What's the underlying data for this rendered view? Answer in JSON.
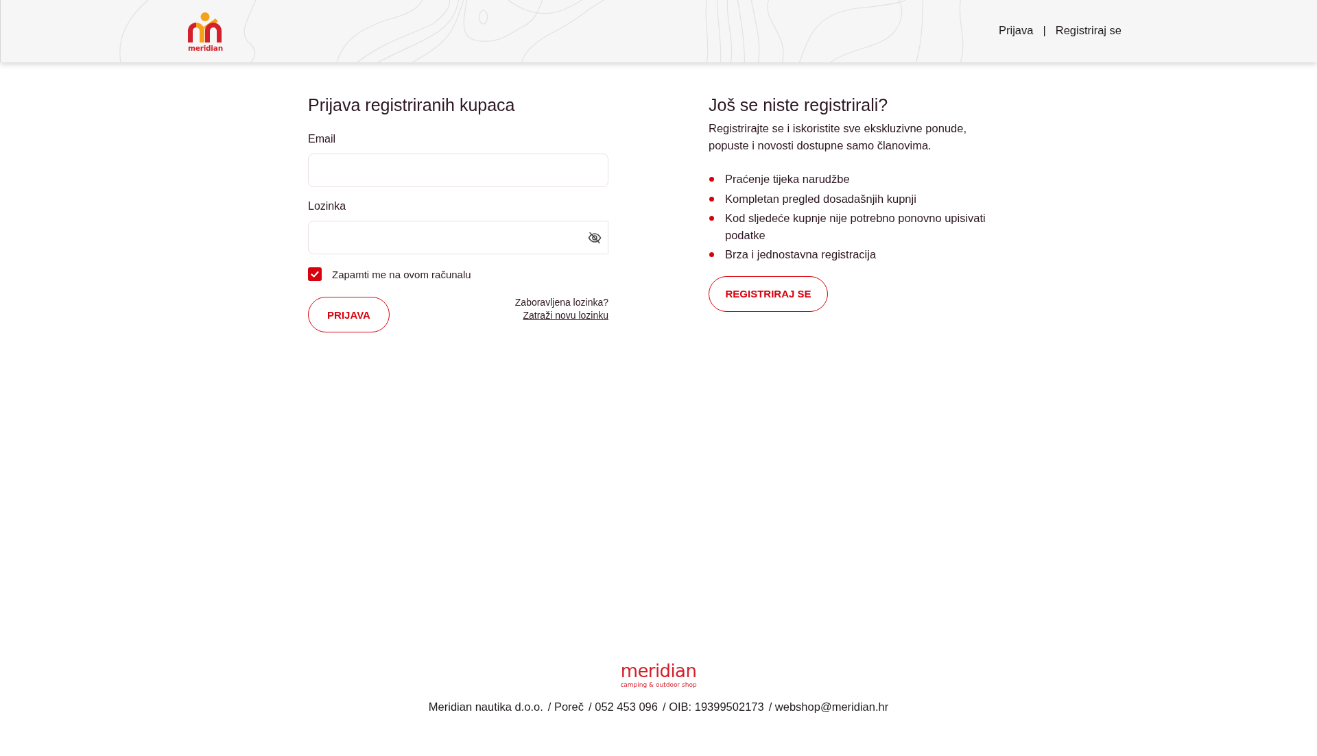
{
  "header": {
    "logo": {
      "wordmark": "meridian"
    },
    "links": [
      {
        "label": "Prijava"
      },
      {
        "label": "Registriraj se"
      }
    ],
    "separator": "|"
  },
  "login": {
    "title": "Prijava registriranih kupaca",
    "fields": [
      {
        "kind": "email",
        "label": "Email"
      },
      {
        "kind": "password",
        "label": "Lozinka"
      }
    ],
    "remember": {
      "label": "Zapamti me na ovom računalu",
      "checked": true
    },
    "submit": "PRIJAVA",
    "forgot": {
      "question": "Zaboravljena lozinka?",
      "link": "Zatraži novu lozinku"
    }
  },
  "register": {
    "title": "Još se niste registrirali?",
    "intro": "Registrirajte se i iskoristite sve ekskluzivne ponude, popuste i novosti dostupne samo članovima.",
    "benefits": [
      "Praćenje tijeka narudžbe",
      "Kompletan pregled dosadašnjih kupnji",
      "Kod sljedeće kupnje nije potrebno ponovno upisivati podatke",
      "Brza i jednostavna registracija"
    ],
    "button": "REGISTRIRAJ SE"
  },
  "footer": {
    "logo": {
      "wordmark": "meridian",
      "tagline": "camping & outdoor shop"
    },
    "items": [
      "Meridian nautika d.o.o.",
      "/ Poreč",
      "/ 052 453 096",
      "/ OIB: 19399502173",
      "/ webshop@meridian.hr"
    ]
  }
}
